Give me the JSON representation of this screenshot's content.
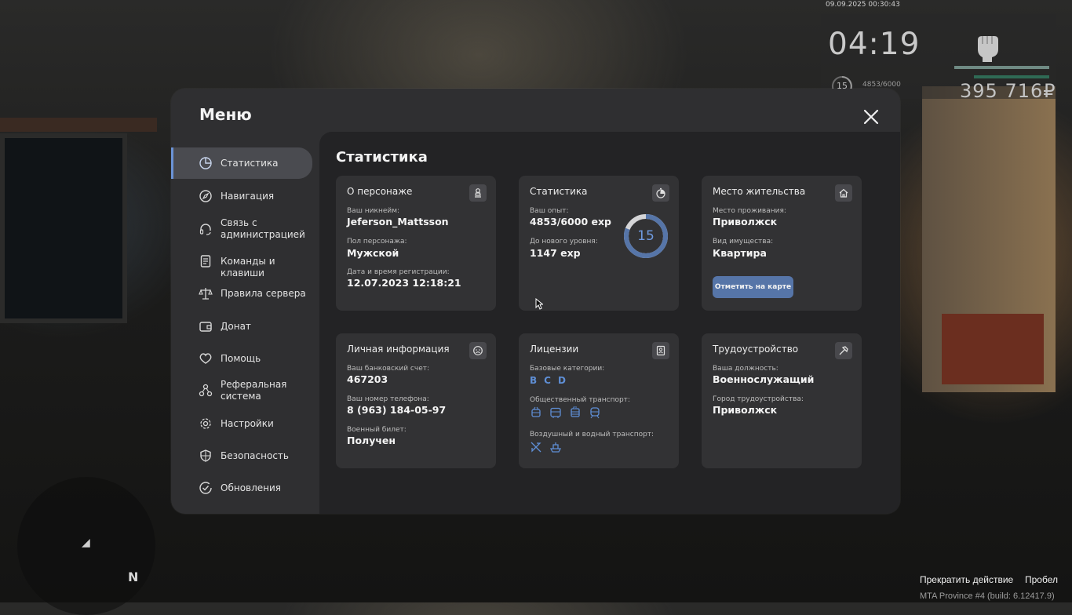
{
  "hud": {
    "datetime": "09.09.2025 00:30:43",
    "time": "04:19",
    "level": "15",
    "exp": "4853/6000",
    "money": "395 716₽"
  },
  "menu": {
    "title": "Меню",
    "sidebar": [
      {
        "label": "Статистика",
        "icon": "pie-chart-icon"
      },
      {
        "label": "Навигация",
        "icon": "compass-icon"
      },
      {
        "label": "Связь с администрацией",
        "icon": "headset-icon"
      },
      {
        "label": "Команды и клавиши",
        "icon": "document-icon"
      },
      {
        "label": "Правила сервера",
        "icon": "scales-icon"
      },
      {
        "label": "Донат",
        "icon": "wallet-icon"
      },
      {
        "label": "Помощь",
        "icon": "heart-hand-icon"
      },
      {
        "label": "Реферальная система",
        "icon": "referral-icon"
      },
      {
        "label": "Настройки",
        "icon": "gear-icon"
      },
      {
        "label": "Безопасность",
        "icon": "shield-icon"
      },
      {
        "label": "Обновления",
        "icon": "check-circle-icon"
      }
    ],
    "content_title": "Статистика",
    "cards": {
      "character": {
        "title": "О персонаже",
        "nick_label": "Ваш никнейм:",
        "nick": "Jeferson_Mattsson",
        "gender_label": "Пол персонажа:",
        "gender": "Мужской",
        "reg_label": "Дата и время регистрации:",
        "reg": "12.07.2023 12:18:21"
      },
      "stats": {
        "title": "Статистика",
        "exp_label": "Ваш опыт:",
        "exp": "4853/6000 exp",
        "next_label": "До нового уровня:",
        "next": "1147 exp",
        "level": "15",
        "progress": 0.8088
      },
      "residence": {
        "title": "Место жительства",
        "place_label": "Место проживания:",
        "place": "Приволжск",
        "type_label": "Вид имущества:",
        "type": "Квартира",
        "button": "Отметить на карте"
      },
      "personal": {
        "title": "Личная информация",
        "bank_label": "Ваш банковский счет:",
        "bank": "467203",
        "phone_label": "Ваш номер телефона:",
        "phone": "8 (963) 184-05-97",
        "military_label": "Военный билет:",
        "military": "Получен"
      },
      "licenses": {
        "title": "Лицензии",
        "base_label": "Базовые категории:",
        "base": [
          "B",
          "C",
          "D"
        ],
        "public_label": "Общественный транспорт:",
        "public_icons": [
          "trolleybus-icon",
          "bus-icon",
          "tram-icon",
          "subway-icon"
        ],
        "air_label": "Воздушный и водный транспорт:",
        "air_icons": [
          "airplane-icon",
          "boat-icon"
        ]
      },
      "job": {
        "title": "Трудоустройство",
        "position_label": "Ваша должность:",
        "position": "Военнослужащий",
        "city_label": "Город трудоустройства:",
        "city": "Приволжск"
      }
    }
  },
  "bottom": {
    "action": "Прекратить действие",
    "key": "Пробел",
    "build": "MTA Province #4 (build: 6.12417.9)"
  },
  "colors": {
    "accent": "#5f8fd6",
    "button": "#5675a8",
    "panel": "#2f2f31",
    "card": "#323234"
  }
}
